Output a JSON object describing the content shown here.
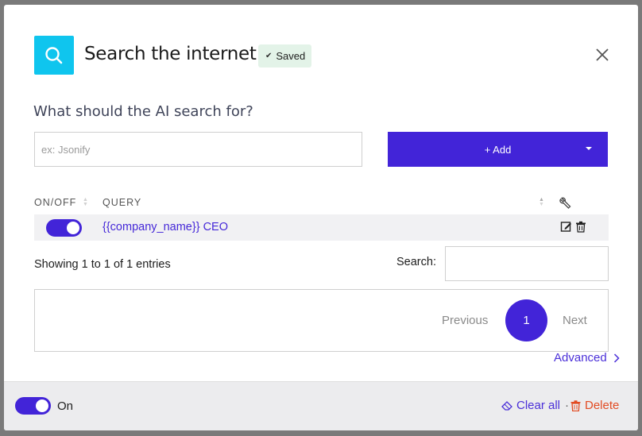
{
  "header": {
    "title": "Search the internet",
    "saved_label": "Saved",
    "icon": "search-icon",
    "icon_bg": "#0fc5ee"
  },
  "form": {
    "question": "What should the AI search for?",
    "input_placeholder": "ex: Jsonify",
    "input_value": "",
    "add_label": "+ Add"
  },
  "table": {
    "headers": {
      "on_off": "ON/OFF",
      "query": "QUERY"
    },
    "rows": [
      {
        "enabled": true,
        "query": "{{company_name}} CEO"
      }
    ],
    "info": "Showing 1 to 1 of 1 entries",
    "search_label": "Search:",
    "search_value": ""
  },
  "pagination": {
    "previous": "Previous",
    "current_page": "1",
    "next": "Next"
  },
  "advanced_label": "Advanced",
  "footer": {
    "enabled": true,
    "on_label": "On",
    "clear_all_label": "Clear all",
    "separator": "·",
    "delete_label": "Delete"
  },
  "colors": {
    "accent": "#4224d8",
    "link": "#4a2fd8",
    "danger": "#e24b22",
    "saved_bg": "#e3f3e8"
  }
}
